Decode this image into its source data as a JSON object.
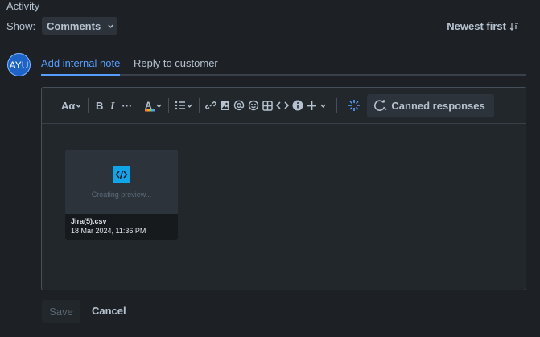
{
  "activity": {
    "title": "Activity"
  },
  "filter": {
    "show_label": "Show:",
    "selected": "Comments"
  },
  "sort": {
    "label": "Newest first"
  },
  "avatar": {
    "initials": "AYU"
  },
  "tabs": [
    {
      "label": "Add internal note",
      "active": true
    },
    {
      "label": "Reply to customer",
      "active": false
    }
  ],
  "toolbar": {
    "text_style": "Aα",
    "more": "···",
    "canned_label": "Canned responses"
  },
  "attachment": {
    "preview_text": "Creating preview...",
    "file_name": "Jira(5).csv",
    "date": "18 Mar 2024, 11:36 PM"
  },
  "actions": {
    "save_label": "Save",
    "cancel_label": "Cancel"
  },
  "colors": {
    "accent": "#579dff",
    "background": "#1d2125",
    "avatar": "#1d63c8",
    "file_icon": "#0ea5e9"
  },
  "icons": [
    "bold-icon",
    "italic-icon",
    "text-color-icon",
    "list-icon",
    "link-icon",
    "image-icon",
    "mention-icon",
    "emoji-icon",
    "table-icon",
    "code-icon",
    "info-icon",
    "plus-icon",
    "ai-sparkle-icon",
    "canned-icon"
  ]
}
